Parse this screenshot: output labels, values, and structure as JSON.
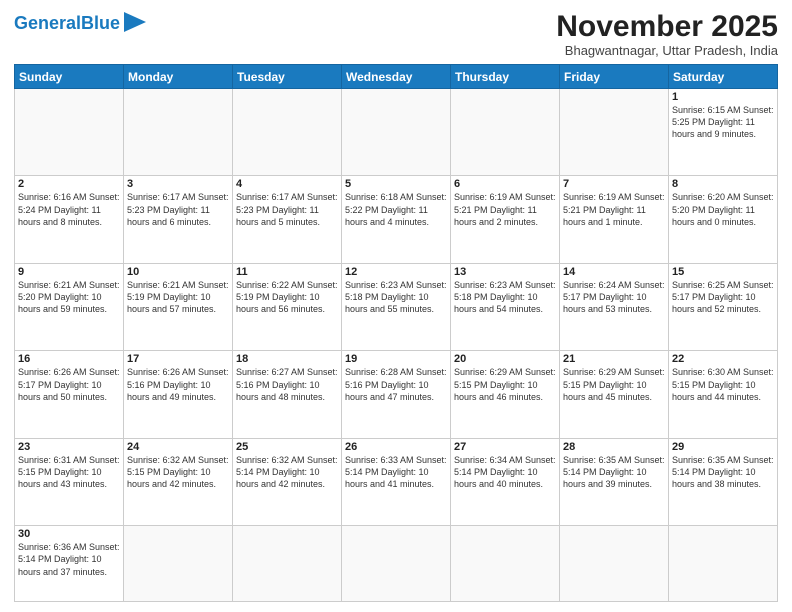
{
  "header": {
    "logo_general": "General",
    "logo_blue": "Blue",
    "month_title": "November 2025",
    "subtitle": "Bhagwantnagar, Uttar Pradesh, India"
  },
  "days_of_week": [
    "Sunday",
    "Monday",
    "Tuesday",
    "Wednesday",
    "Thursday",
    "Friday",
    "Saturday"
  ],
  "weeks": [
    [
      {
        "day": "",
        "info": ""
      },
      {
        "day": "",
        "info": ""
      },
      {
        "day": "",
        "info": ""
      },
      {
        "day": "",
        "info": ""
      },
      {
        "day": "",
        "info": ""
      },
      {
        "day": "",
        "info": ""
      },
      {
        "day": "1",
        "info": "Sunrise: 6:15 AM\nSunset: 5:25 PM\nDaylight: 11 hours\nand 9 minutes."
      }
    ],
    [
      {
        "day": "2",
        "info": "Sunrise: 6:16 AM\nSunset: 5:24 PM\nDaylight: 11 hours\nand 8 minutes."
      },
      {
        "day": "3",
        "info": "Sunrise: 6:17 AM\nSunset: 5:23 PM\nDaylight: 11 hours\nand 6 minutes."
      },
      {
        "day": "4",
        "info": "Sunrise: 6:17 AM\nSunset: 5:23 PM\nDaylight: 11 hours\nand 5 minutes."
      },
      {
        "day": "5",
        "info": "Sunrise: 6:18 AM\nSunset: 5:22 PM\nDaylight: 11 hours\nand 4 minutes."
      },
      {
        "day": "6",
        "info": "Sunrise: 6:19 AM\nSunset: 5:21 PM\nDaylight: 11 hours\nand 2 minutes."
      },
      {
        "day": "7",
        "info": "Sunrise: 6:19 AM\nSunset: 5:21 PM\nDaylight: 11 hours\nand 1 minute."
      },
      {
        "day": "8",
        "info": "Sunrise: 6:20 AM\nSunset: 5:20 PM\nDaylight: 11 hours\nand 0 minutes."
      }
    ],
    [
      {
        "day": "9",
        "info": "Sunrise: 6:21 AM\nSunset: 5:20 PM\nDaylight: 10 hours\nand 59 minutes."
      },
      {
        "day": "10",
        "info": "Sunrise: 6:21 AM\nSunset: 5:19 PM\nDaylight: 10 hours\nand 57 minutes."
      },
      {
        "day": "11",
        "info": "Sunrise: 6:22 AM\nSunset: 5:19 PM\nDaylight: 10 hours\nand 56 minutes."
      },
      {
        "day": "12",
        "info": "Sunrise: 6:23 AM\nSunset: 5:18 PM\nDaylight: 10 hours\nand 55 minutes."
      },
      {
        "day": "13",
        "info": "Sunrise: 6:23 AM\nSunset: 5:18 PM\nDaylight: 10 hours\nand 54 minutes."
      },
      {
        "day": "14",
        "info": "Sunrise: 6:24 AM\nSunset: 5:17 PM\nDaylight: 10 hours\nand 53 minutes."
      },
      {
        "day": "15",
        "info": "Sunrise: 6:25 AM\nSunset: 5:17 PM\nDaylight: 10 hours\nand 52 minutes."
      }
    ],
    [
      {
        "day": "16",
        "info": "Sunrise: 6:26 AM\nSunset: 5:17 PM\nDaylight: 10 hours\nand 50 minutes."
      },
      {
        "day": "17",
        "info": "Sunrise: 6:26 AM\nSunset: 5:16 PM\nDaylight: 10 hours\nand 49 minutes."
      },
      {
        "day": "18",
        "info": "Sunrise: 6:27 AM\nSunset: 5:16 PM\nDaylight: 10 hours\nand 48 minutes."
      },
      {
        "day": "19",
        "info": "Sunrise: 6:28 AM\nSunset: 5:16 PM\nDaylight: 10 hours\nand 47 minutes."
      },
      {
        "day": "20",
        "info": "Sunrise: 6:29 AM\nSunset: 5:15 PM\nDaylight: 10 hours\nand 46 minutes."
      },
      {
        "day": "21",
        "info": "Sunrise: 6:29 AM\nSunset: 5:15 PM\nDaylight: 10 hours\nand 45 minutes."
      },
      {
        "day": "22",
        "info": "Sunrise: 6:30 AM\nSunset: 5:15 PM\nDaylight: 10 hours\nand 44 minutes."
      }
    ],
    [
      {
        "day": "23",
        "info": "Sunrise: 6:31 AM\nSunset: 5:15 PM\nDaylight: 10 hours\nand 43 minutes."
      },
      {
        "day": "24",
        "info": "Sunrise: 6:32 AM\nSunset: 5:15 PM\nDaylight: 10 hours\nand 42 minutes."
      },
      {
        "day": "25",
        "info": "Sunrise: 6:32 AM\nSunset: 5:14 PM\nDaylight: 10 hours\nand 42 minutes."
      },
      {
        "day": "26",
        "info": "Sunrise: 6:33 AM\nSunset: 5:14 PM\nDaylight: 10 hours\nand 41 minutes."
      },
      {
        "day": "27",
        "info": "Sunrise: 6:34 AM\nSunset: 5:14 PM\nDaylight: 10 hours\nand 40 minutes."
      },
      {
        "day": "28",
        "info": "Sunrise: 6:35 AM\nSunset: 5:14 PM\nDaylight: 10 hours\nand 39 minutes."
      },
      {
        "day": "29",
        "info": "Sunrise: 6:35 AM\nSunset: 5:14 PM\nDaylight: 10 hours\nand 38 minutes."
      }
    ],
    [
      {
        "day": "30",
        "info": "Sunrise: 6:36 AM\nSunset: 5:14 PM\nDaylight: 10 hours\nand 37 minutes."
      },
      {
        "day": "",
        "info": ""
      },
      {
        "day": "",
        "info": ""
      },
      {
        "day": "",
        "info": ""
      },
      {
        "day": "",
        "info": ""
      },
      {
        "day": "",
        "info": ""
      },
      {
        "day": "",
        "info": ""
      }
    ]
  ]
}
